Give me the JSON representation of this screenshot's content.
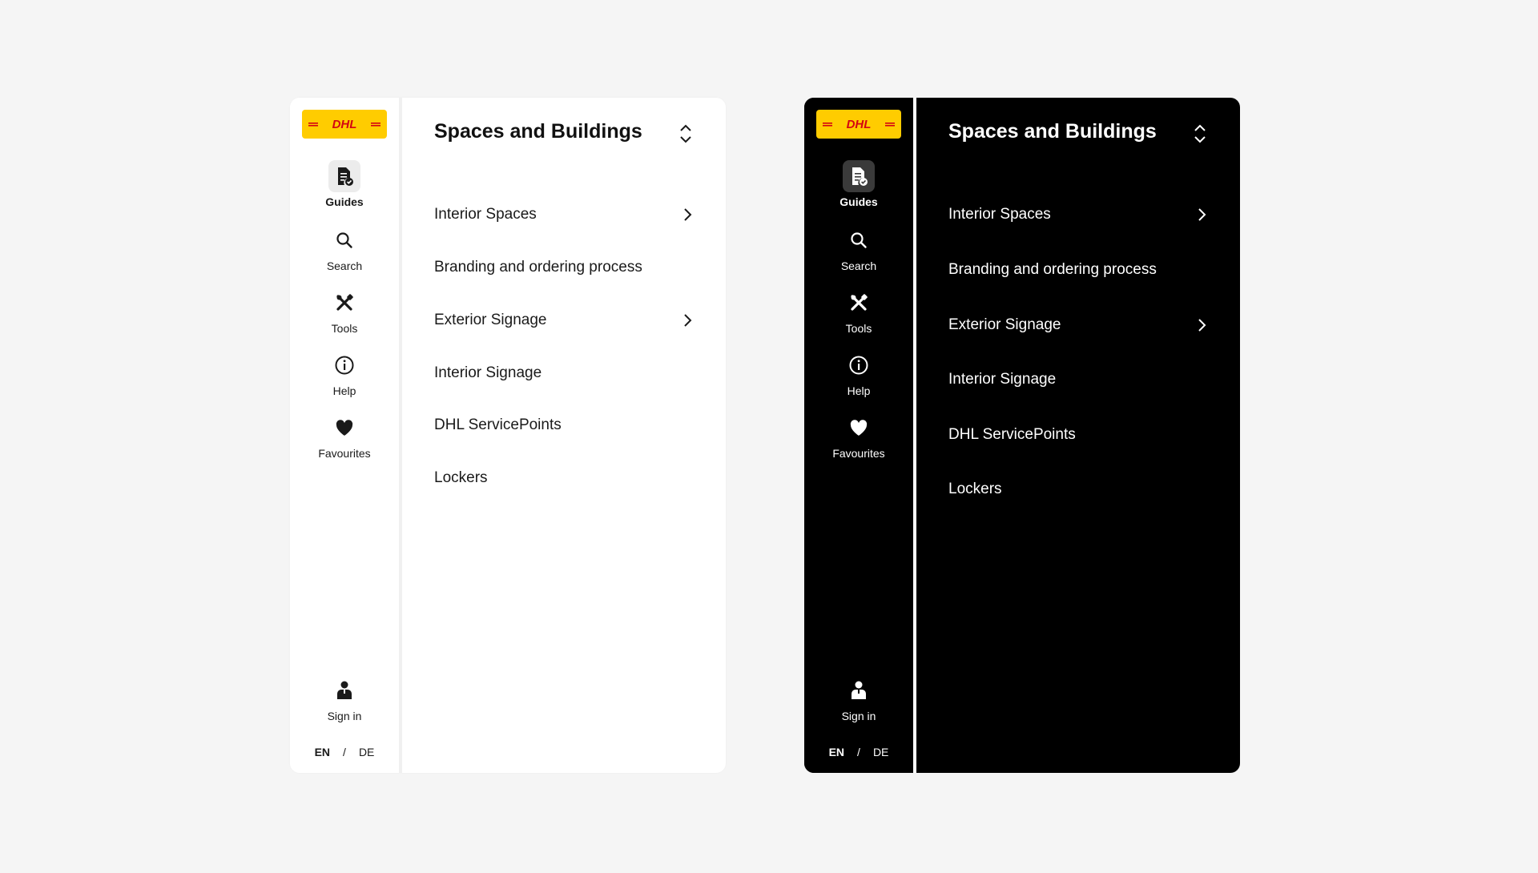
{
  "brand": {
    "logo_text": "DHL",
    "accent": "#ffcc00",
    "logo_red": "#d40511"
  },
  "themes": {
    "light": {
      "background": "#ffffff",
      "text": "#1a1a1a"
    },
    "dark": {
      "background": "#000000",
      "text": "#ffffff"
    }
  },
  "rail": {
    "items": [
      {
        "label": "Guides",
        "icon": "guides-icon",
        "active": true
      },
      {
        "label": "Search",
        "icon": "search-icon",
        "active": false
      },
      {
        "label": "Tools",
        "icon": "tools-icon",
        "active": false
      },
      {
        "label": "Help",
        "icon": "info-icon",
        "active": false
      },
      {
        "label": "Favourites",
        "icon": "heart-icon",
        "active": false
      }
    ],
    "sign_in": {
      "label": "Sign in",
      "icon": "user-icon"
    },
    "lang": {
      "en": "EN",
      "separator": "/",
      "de": "DE",
      "selected": "EN"
    }
  },
  "main": {
    "title": "Spaces and Buildings",
    "switcher_icon": "chevron-up-down-icon",
    "items": [
      {
        "label": "Interior Spaces",
        "has_children": true
      },
      {
        "label": "Branding and ordering process",
        "has_children": false
      },
      {
        "label": "Exterior Signage",
        "has_children": true
      },
      {
        "label": "Interior Signage",
        "has_children": false
      },
      {
        "label": "DHL ServicePoints",
        "has_children": false
      },
      {
        "label": "Lockers",
        "has_children": false
      }
    ]
  }
}
